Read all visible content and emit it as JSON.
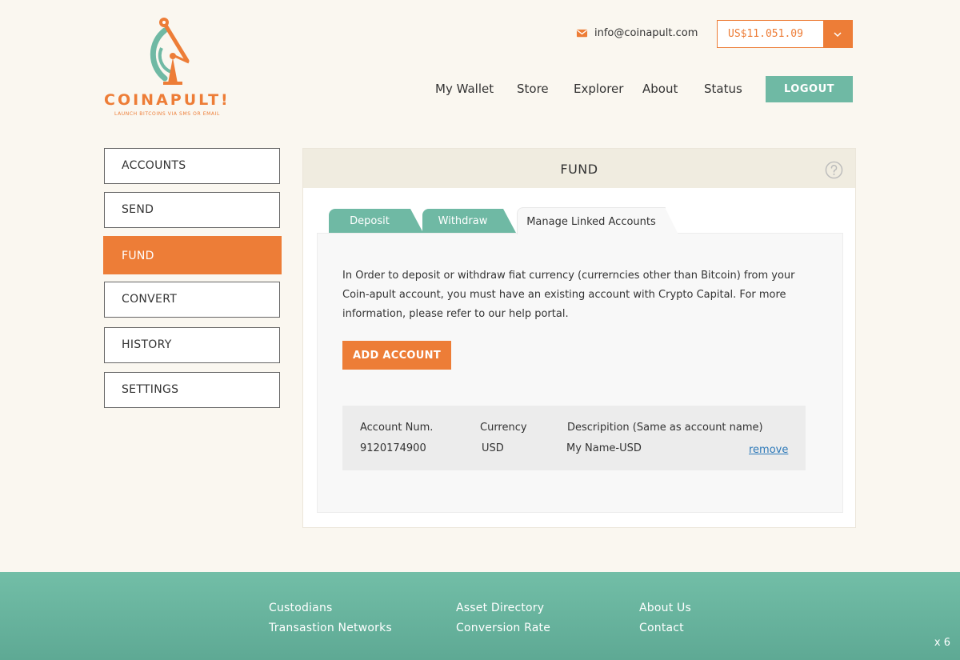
{
  "logo": {
    "wordmark": "COINAPULT!",
    "tagline": "LAUNCH BITCOINS VIA SMS OR EMAIL"
  },
  "header": {
    "email": "info@coinapult.com",
    "balance": "US$11.051.09",
    "nav": [
      "My Wallet",
      "Store",
      "Explorer",
      "About",
      "Status"
    ],
    "logout": "LOGOUT"
  },
  "sidebar": {
    "items": [
      "ACCOUNTS",
      "SEND",
      "FUND",
      "CONVERT",
      "HISTORY",
      "SETTINGS"
    ],
    "active": "FUND"
  },
  "panel": {
    "title": "FUND",
    "tabs": [
      "Deposit",
      "Withdraw",
      "Manage Linked Accounts"
    ],
    "active_tab": "Manage Linked Accounts",
    "info": "In Order to deposit or withdraw fiat currency (currerncies other than Bitcoin) from your Coin-apult account, you must have an existing account with Crypto Capital. For more information, please refer to our help portal.",
    "add_button": "ADD ACCOUNT",
    "table": {
      "headers": [
        "Account Num.",
        "Currency",
        "Descripition (Same as account name)"
      ],
      "rows": [
        {
          "account": "9120174900",
          "currency": "USD",
          "description": "My Name-USD",
          "action": "remove"
        }
      ]
    }
  },
  "footer": {
    "col1": [
      "Custodians",
      "Transastion Networks"
    ],
    "col2": [
      "Asset Directory",
      "Conversion Rate"
    ],
    "col3": [
      "About Us",
      "Contact"
    ]
  },
  "overlay": {
    "zoom": "x 6"
  },
  "colors": {
    "accent": "#ed7d37",
    "teal": "#6fb9a4",
    "background": "#faf7f0"
  }
}
